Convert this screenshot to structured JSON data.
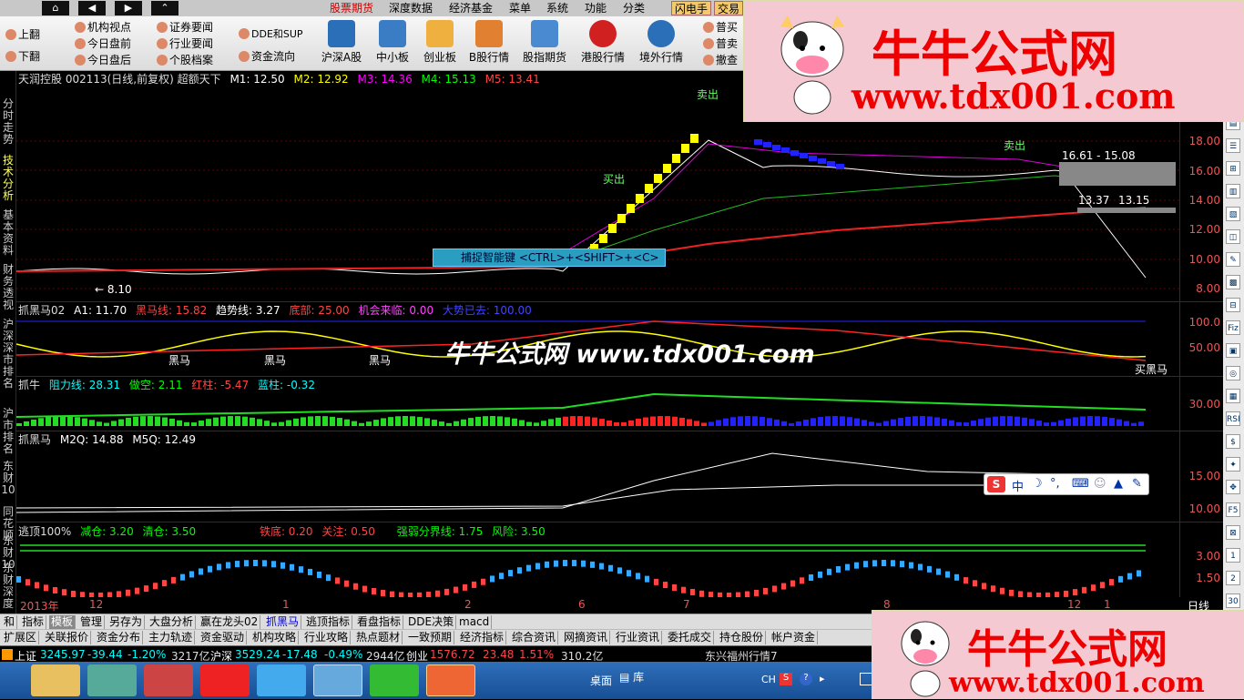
{
  "menubar": {
    "nav_buttons": [
      "⌂",
      "◀",
      "▶",
      "⌃"
    ],
    "menus": [
      "股票期货",
      "深度数据",
      "经济基金",
      "菜单",
      "系统",
      "功能",
      "分类"
    ],
    "flash": "闪电手",
    "trade": "交易"
  },
  "toolbar": {
    "left": [
      "上翻",
      "下翻"
    ],
    "col1": [
      "机构视点",
      "今日盘前",
      "今日盘后"
    ],
    "col2": [
      "证券要闻",
      "行业要闻",
      "个股档案"
    ],
    "col3": [
      "DDE和SUP",
      "资金流向"
    ],
    "big": [
      "沪深A股",
      "中小板",
      "创业板",
      "B股行情",
      "股指期货",
      "港股行情",
      "境外行情"
    ],
    "right": [
      "普买",
      "普卖",
      "撤查"
    ]
  },
  "leftnav": [
    "分时走势",
    "技术分析",
    "基本资料",
    "财务透视",
    "沪深深市排名",
    "沪市排名",
    "东财10",
    "同花顺",
    "东财10",
    "东财深度"
  ],
  "main_chart": {
    "title": "天润控股 002113(日线,前复权) 超额天下",
    "ma": [
      {
        "label": "M1: 12.50",
        "color": "#ffffff"
      },
      {
        "label": "M2: 12.92",
        "color": "#ffff00"
      },
      {
        "label": "M3: 14.36",
        "color": "#ff00ff"
      },
      {
        "label": "M4: 15.13",
        "color": "#00ff00"
      },
      {
        "label": "M5: 13.41",
        "color": "#ff4040"
      }
    ],
    "y_labels": [
      "18.00",
      "16.00",
      "14.00",
      "12.00",
      "10.00",
      "8.00"
    ],
    "annotations": [
      "8.10",
      "16.61 - 15.08",
      "13.37",
      "13.15",
      "卖出",
      "买出",
      "卖出"
    ],
    "hint": "捕捉智能键 <CTRL>+<SHIFT>+<C>"
  },
  "panel2": {
    "title": "抓黑马02",
    "values": [
      {
        "label": "A1: 11.70",
        "color": "#ffffff"
      },
      {
        "label": "黑马线: 15.82",
        "color": "#ff4040"
      },
      {
        "label": "趋势线: 3.27",
        "color": "#ffffff"
      },
      {
        "label": "底部: 25.00",
        "color": "#ff4040"
      },
      {
        "label": "机会来临: 0.00",
        "color": "#ff40ff"
      },
      {
        "label": "大势已去: 100.00",
        "color": "#4040ff"
      }
    ],
    "y_labels": [
      "100.0",
      "50.00"
    ],
    "marks": [
      "黑马",
      "黑马",
      "黑马",
      "买黑马"
    ]
  },
  "panel3": {
    "title": "抓牛",
    "values": [
      {
        "label": "阻力线: 28.31",
        "color": "#00ffff"
      },
      {
        "label": "做空: 2.11",
        "color": "#00ff00"
      },
      {
        "label": "红柱: -5.47",
        "color": "#ff4040"
      },
      {
        "label": "蓝柱: -0.32",
        "color": "#00ffff"
      }
    ],
    "y_labels": [
      "30.00"
    ]
  },
  "panel4": {
    "title": "抓黑马",
    "values": [
      {
        "label": "M2Q: 14.88",
        "color": "#ffffff"
      },
      {
        "label": "M5Q: 12.49",
        "color": "#ffffff"
      }
    ],
    "y_labels": [
      "15.00",
      "10.00"
    ]
  },
  "panel5": {
    "title": "逃顶100%",
    "values": [
      {
        "label": "减仓: 3.20",
        "color": "#00ff00"
      },
      {
        "label": "清仓: 3.50",
        "color": "#00ff00"
      },
      {
        "label": "铁底: 0.20",
        "color": "#ff4040"
      },
      {
        "label": "关注: 0.50",
        "color": "#ff4040"
      },
      {
        "label": "强弱分界线: 1.75",
        "color": "#00ff00"
      },
      {
        "label": "风险: 3.50",
        "color": "#00ff00"
      }
    ],
    "y_labels": [
      "3.00",
      "1.50"
    ]
  },
  "xaxis": [
    "2013年",
    "12",
    "1",
    "2",
    "6",
    "7",
    "8",
    "12",
    "1",
    "日线"
  ],
  "tabs1": [
    "和",
    "指标",
    "模板",
    "管理",
    "另存为",
    "大盘分析",
    "赢在龙头02",
    "抓黑马",
    "逃顶指标",
    "看盘指标",
    "DDE决策",
    "macd"
  ],
  "tabs2": [
    "扩展区",
    "关联报价",
    "资金分布",
    "主力轨迹",
    "资金驱动",
    "机构攻略",
    "行业攻略",
    "热点题材",
    "一致预期",
    "经济指标",
    "综合资讯",
    "网摘资讯",
    "行业资讯",
    "委托成交",
    "持仓股份",
    "帐户资金"
  ],
  "status": {
    "sh_label": "上证",
    "sh_value": "3245.97",
    "sh_change": "-39.44",
    "sh_pct": "-1.20%",
    "sh_amount": "3217亿",
    "hs_label": "沪深",
    "hs_value": "3529.24",
    "hs_change": "-17.48",
    "hs_pct": "-0.49%",
    "hs_amount": "2944亿",
    "cy_label": "创业",
    "cy_value": "1576.72",
    "cy_change": "23.48",
    "cy_pct": "1.51%",
    "cy_amount": "310.2亿",
    "ticker": "东兴福州行情7"
  },
  "taskbar": {
    "desktop": "桌面",
    "lib": "库",
    "tray": "CH"
  },
  "watermark": {
    "name": "牛牛公式网",
    "url": "www.tdx001.com",
    "center": "牛牛公式网 www.tdx001.com"
  },
  "ime": {
    "label": "中"
  },
  "colors": {
    "up": "#ff4040",
    "down": "#00ffff",
    "accent": "#cc0000"
  }
}
